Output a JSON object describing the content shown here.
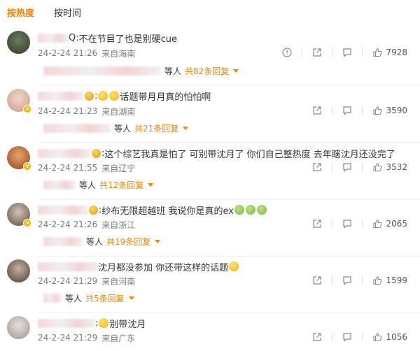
{
  "tabs": [
    {
      "label": "按热度",
      "active": true
    },
    {
      "label": "按时间",
      "active": false
    }
  ],
  "colors": {
    "accent": "#ff8200",
    "meta": "#7a7a7a"
  },
  "comments": [
    {
      "name_visible": "Q:",
      "text": "不在节目了也是别硬cue",
      "date": "24-2-24 21:26",
      "location": "来自海南",
      "likes": "7928",
      "reply_who": "等人",
      "reply_link": "共82条回复"
    },
    {
      "name_visible": ":",
      "text": "话题带月月真的怕怕啊",
      "date": "24-2-24 21:23",
      "location": "来自湖南",
      "likes": "3590",
      "reply_who": "等人",
      "reply_link": "共21条回复"
    },
    {
      "name_visible": ":",
      "text": "这个综艺我真是怕了  可别带沈月了  你们自己整热度  去年瞎沈月还没完了",
      "date": "24-2-24 21:55",
      "location": "来自辽宁",
      "likes": "3532",
      "reply_who": "等人",
      "reply_link": "共12条回复"
    },
    {
      "name_visible": ":",
      "text": "纱布无限超越班 我说你是真的ex",
      "date": "24-2-24 21:26",
      "location": "来自浙江",
      "likes": "2065",
      "reply_who": "等人",
      "reply_link": "共19条回复"
    },
    {
      "name_visible": "",
      "text": "沈月都没参加 你还带这样的话题",
      "date": "24-2-24 21:29",
      "location": "来自河南",
      "likes": "1599",
      "reply_who": "等人",
      "reply_link": "共5条回复"
    },
    {
      "name_visible": ":",
      "text": "别带沈月",
      "date": "24-2-24 21:29",
      "location": "来自广东",
      "likes": "1056",
      "reply_who": "",
      "reply_link": ""
    }
  ]
}
